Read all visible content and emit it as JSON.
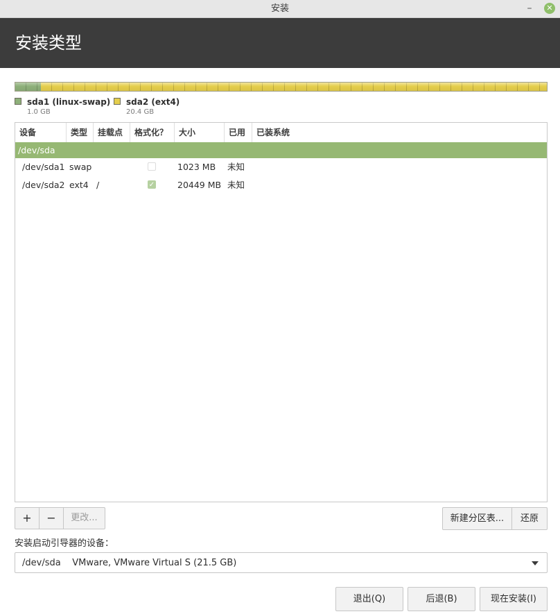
{
  "window": {
    "title": "安装",
    "minimize_glyph": "–",
    "close_glyph": "✕"
  },
  "header": {
    "title": "安装类型"
  },
  "colors": {
    "header_bg": "#3c3c3c",
    "selection": "#96b873",
    "swap_color": "#8eb07a",
    "ext4_color": "#e5ce4c"
  },
  "partition_bar": {
    "segments": [
      {
        "name": "sda1 (linux-swap)",
        "size": "1.0 GB",
        "fraction": 0.048
      },
      {
        "name": "sda2 (ext4)",
        "size": "20.4 GB",
        "fraction": 0.952
      }
    ]
  },
  "table": {
    "columns": [
      "设备",
      "类型",
      "挂载点",
      "格式化？",
      "大小",
      "已用",
      "已装系统"
    ],
    "rows": [
      {
        "device": "/dev/sda",
        "type": "",
        "mount": "",
        "format": null,
        "size": "",
        "used": "",
        "system": "",
        "selected": true
      },
      {
        "device": "/dev/sda1",
        "type": "swap",
        "mount": "",
        "format": false,
        "size": "1023 MB",
        "used": "未知",
        "system": "",
        "selected": false
      },
      {
        "device": "/dev/sda2",
        "type": "ext4",
        "mount": "/",
        "format": true,
        "size": "20449 MB",
        "used": "未知",
        "system": "",
        "selected": false
      }
    ]
  },
  "toolbar": {
    "add_label": "+",
    "remove_label": "−",
    "change_label": "更改..."
  },
  "right_buttons": {
    "new_table_label": "新建分区表...",
    "revert_label": "还原"
  },
  "bootloader": {
    "label": "安装启动引导器的设备：",
    "selected": "/dev/sda    VMware, VMware Virtual S (21.5 GB)"
  },
  "footer": {
    "quit_label": "退出(Q)",
    "back_label": "后退(B)",
    "install_label": "现在安装(I)"
  }
}
